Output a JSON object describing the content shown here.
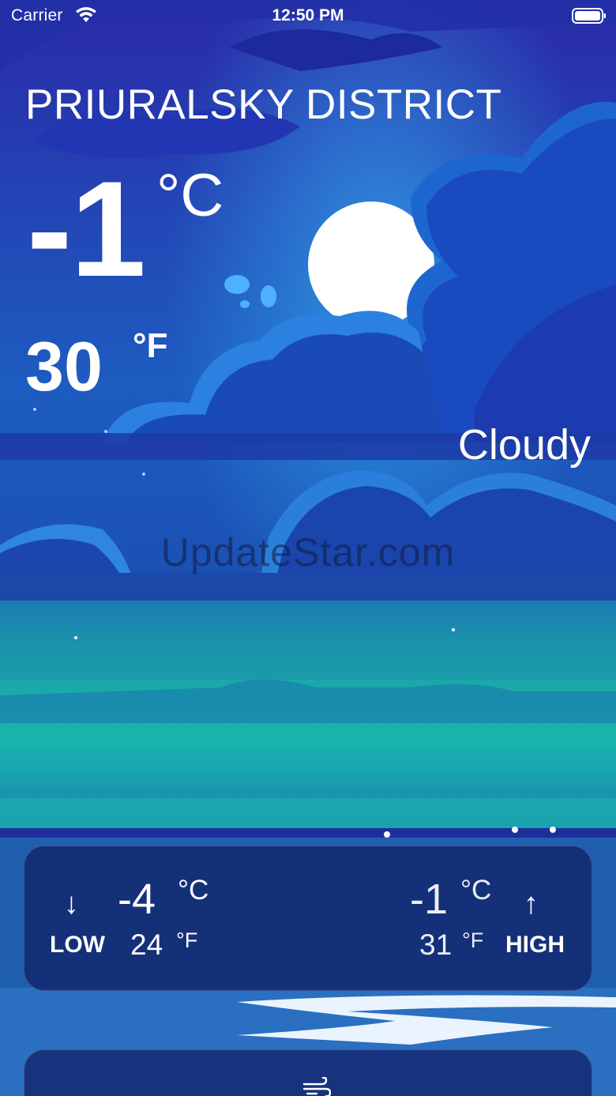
{
  "status_bar": {
    "carrier": "Carrier",
    "time": "12:50 PM"
  },
  "location": "PRIURALSKY DISTRICT",
  "current": {
    "celsius": "-1",
    "celsius_unit": "°C",
    "fahrenheit": "30",
    "fahrenheit_unit": "°F",
    "condition": "Cloudy"
  },
  "watermark": "UpdateStar.com",
  "range": {
    "low": {
      "label": "LOW",
      "celsius": "-4",
      "fahrenheit": "24",
      "c_unit": "°C",
      "f_unit": "°F",
      "arrow": "↓"
    },
    "high": {
      "label": "HIGH",
      "celsius": "-1",
      "fahrenheit": "31",
      "c_unit": "°C",
      "f_unit": "°F",
      "arrow": "↑"
    }
  },
  "icons": [
    "wifi-icon",
    "battery-icon",
    "arrow-down-icon",
    "arrow-up-icon",
    "wind-icon"
  ],
  "colors": {
    "sky_top": "#1f2a9a",
    "sea": "#1aa3a8",
    "card_bg": "#12266e",
    "moon": "#ffffff"
  }
}
